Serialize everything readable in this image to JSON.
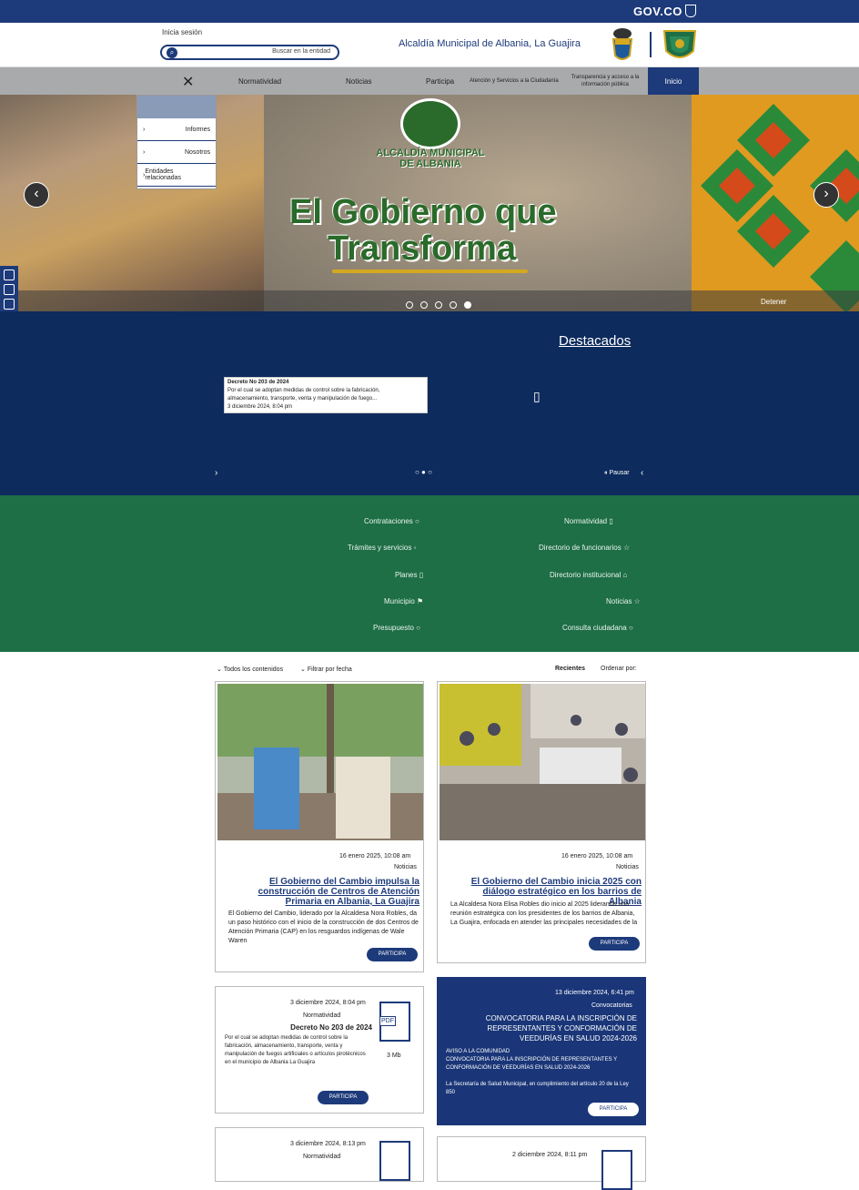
{
  "gov": {
    "label": "GOV.CO"
  },
  "header": {
    "login": "Inicia sesión",
    "search_placeholder": "Buscar en la entidad",
    "site_title": "Alcaldía Municipal de Albania, La Guajira"
  },
  "nav": {
    "items": [
      {
        "label": "Inicio"
      },
      {
        "label": "Transparencia y acceso a la información pública"
      },
      {
        "label": "Atención y Servicios a la Ciudadanía"
      },
      {
        "label": "Participa"
      },
      {
        "label": "Noticias"
      },
      {
        "label": "Normatividad"
      }
    ],
    "dropdown": [
      "Informes",
      "Nosotros",
      "Entidades relacionadas"
    ]
  },
  "hero": {
    "org_line1": "ALCALDÍA MUNICIPAL",
    "org_line2": "DE ALBANIA",
    "title_line1": "El Gobierno que",
    "title_line2": "Transforma",
    "stop_label": "Detener"
  },
  "destacados": {
    "title": "Destacados",
    "card_title": "Decreto No 203 de 2024",
    "card_text1": "Por el cual se adoptan medidas de control sobre la fabricación,",
    "card_text2": "almacenamiento, transporte, venta y manipulación de fuego...",
    "card_date": "3 diciembre 2024, 8:04 pm",
    "pause_label": "Pausar"
  },
  "quick_links": {
    "left": [
      "Normatividad",
      "Directorio de funcionarios",
      "Directorio institucional",
      "Noticias",
      "Consulta ciudadana"
    ],
    "right": [
      "Contrataciones",
      "Trámites y servicios",
      "Planes",
      "Municipio",
      "Presupuesto"
    ]
  },
  "filters": {
    "order_label": "Ordenar por:",
    "order_value": "Recientes",
    "filter_label": "Filtrar por fecha",
    "content_label": "Todos los contenidos"
  },
  "cards": [
    {
      "date": "16 enero 2025, 10:08 am",
      "category": "Noticias",
      "title": "El Gobierno del Cambio inicia 2025 con diálogo estratégico en los barrios de Albania",
      "text": "La Alcaldesa Nora Elisa Robles dio inicio al 2025 liderando una reunión estratégica con los presidentes de los barrios de Albania, La Guajira, enfocada en atender las principales necesidades de la",
      "button": "PARTICIPA"
    },
    {
      "date": "16 enero 2025, 10:08 am",
      "category": "Noticias",
      "title": "El Gobierno del Cambio impulsa la construcción de Centros de Atención Primaria en Albania, La Guajira",
      "text": "El Gobierno del Cambio, liderado por la Alcaldesa Nora Robles, da un paso histórico con el inicio de la construcción de dos Centros de Atención Primaria (CAP) en los resguardos indígenas de Wale Waren",
      "button": "PARTICIPA"
    }
  ],
  "convocatoria": {
    "date": "13 diciembre 2024, 6:41 pm",
    "category": "Convocatorias",
    "title": "CONVOCATORIA PARA LA INSCRIPCIÓN DE REPRESENTANTES Y CONFORMACIÓN DE VEEDURÍAS EN SALUD 2024-2026",
    "text1": "AVISO A LA COMUNIDAD",
    "text2": "CONVOCATORIA PARA LA INSCRIPCIÓN DE REPRESENTANTES Y CONFORMACIÓN DE VEEDURÍAS EN SALUD 2024-2026",
    "text3": "La Secretaría de Salud Municipal, en cumplimiento del artículo 20 de la Ley 850",
    "button": "PARTICIPA"
  },
  "decreto": {
    "date": "3 diciembre 2024, 8:04 pm",
    "category": "Normatividad",
    "title": "Decreto No 203 de 2024",
    "text": "Por el cual se adoptan medidas de control sobre la fabricación, almacenamiento, transporte, venta y manipulación de fuegos artificiales o artículos pirotécnicos en el municipio de Albania La Guajira",
    "size": "3 Mb",
    "pdf": "PDF",
    "button": "PARTICIPA"
  },
  "bottom_cards": [
    {
      "date": "3 diciembre 2024, 8:13 pm",
      "category": "Normatividad"
    },
    {
      "date": "2 diciembre 2024, 8:11 pm"
    }
  ]
}
